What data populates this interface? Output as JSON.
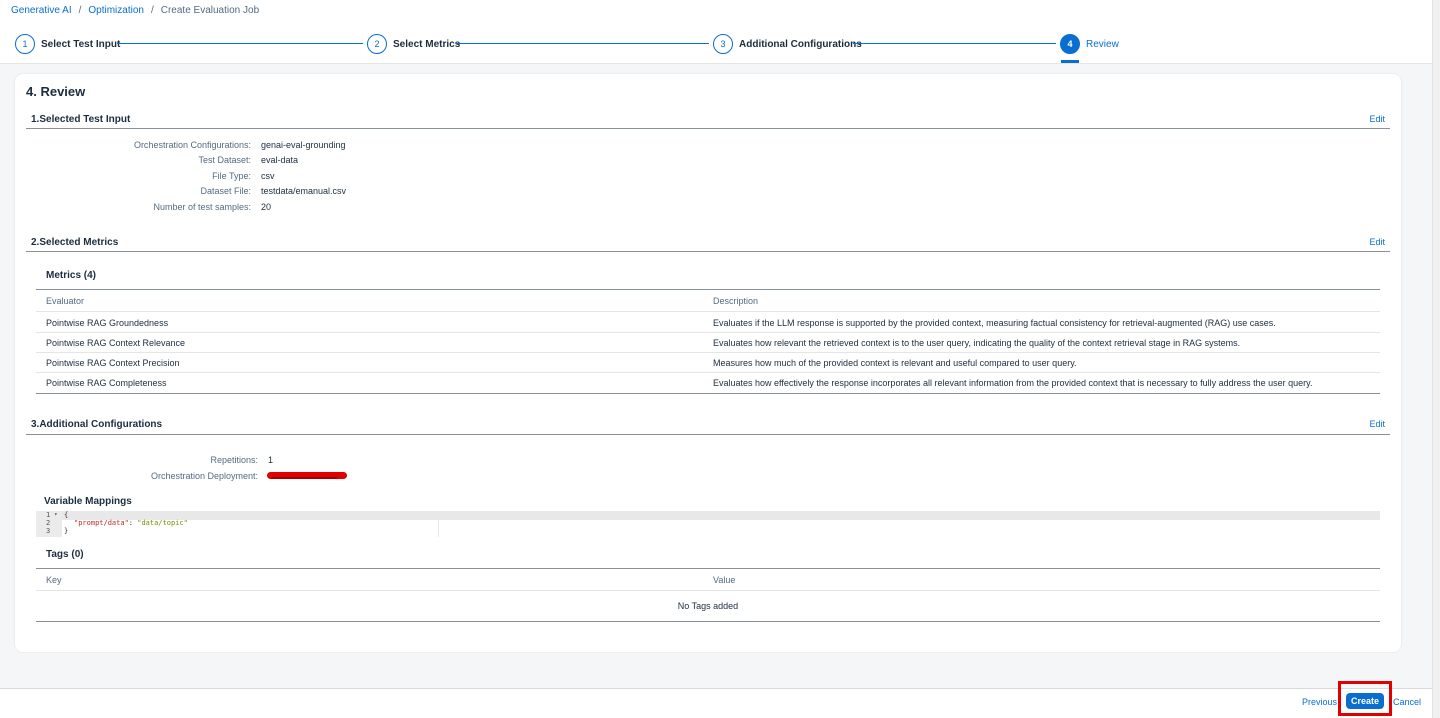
{
  "breadcrumb": {
    "items": [
      "Generative AI",
      "Optimization"
    ],
    "separator": "/",
    "current": "Create Evaluation Job"
  },
  "steps": [
    {
      "number": "1",
      "label": "Select Test Input"
    },
    {
      "number": "2",
      "label": "Select Metrics"
    },
    {
      "number": "3",
      "label": "Additional Configurations"
    },
    {
      "number": "4",
      "label": "Review",
      "active": true
    }
  ],
  "page_title": "4. Review",
  "sections": {
    "test_input": {
      "title": "1.Selected Test Input",
      "edit": "Edit",
      "fields": [
        {
          "label": "Orchestration Configurations:",
          "value": "genai-eval-grounding"
        },
        {
          "label": "Test Dataset:",
          "value": "eval-data"
        },
        {
          "label": "File Type:",
          "value": "csv"
        },
        {
          "label": "Dataset File:",
          "value": "testdata/emanual.csv"
        },
        {
          "label": "Number of test samples:",
          "value": "20"
        }
      ]
    },
    "metrics": {
      "title": "2.Selected Metrics",
      "edit": "Edit",
      "table_title": "Metrics (4)",
      "columns": [
        "Evaluator",
        "Description"
      ],
      "rows": [
        {
          "evaluator": "Pointwise RAG Groundedness",
          "description": "Evaluates if the LLM response is supported by the provided context, measuring factual consistency for retrieval-augmented (RAG) use cases."
        },
        {
          "evaluator": "Pointwise RAG Context Relevance",
          "description": "Evaluates how relevant the retrieved context is to the user query, indicating the quality of the context retrieval stage in RAG systems."
        },
        {
          "evaluator": "Pointwise RAG Context Precision",
          "description": "Measures how much of the provided context is relevant and useful compared to user query."
        },
        {
          "evaluator": "Pointwise RAG Completeness",
          "description": "Evaluates how effectively the response incorporates all relevant information from the provided context that is necessary to fully address the user query."
        }
      ]
    },
    "additional": {
      "title": "3.Additional Configurations",
      "edit": "Edit",
      "fields": [
        {
          "label": "Repetitions:",
          "value": "1"
        },
        {
          "label": "Orchestration Deployment:",
          "value": ""
        }
      ],
      "variable_mappings_title": "Variable Mappings",
      "code_lines": [
        {
          "num": "1",
          "marker": "▾",
          "text": "{"
        },
        {
          "num": "2",
          "key": "\"prompt/data\"",
          "colon": ": ",
          "value": "\"data/topic\""
        },
        {
          "num": "3",
          "text": "}"
        }
      ],
      "tags_title": "Tags (0)",
      "tags_columns": [
        "Key",
        "Value"
      ],
      "tags_empty": "No Tags added"
    }
  },
  "footer": {
    "previous": "Previous",
    "create": "Create",
    "cancel": "Cancel"
  },
  "colors": {
    "accent": "#0a6ed1",
    "highlight": "#e00000"
  }
}
